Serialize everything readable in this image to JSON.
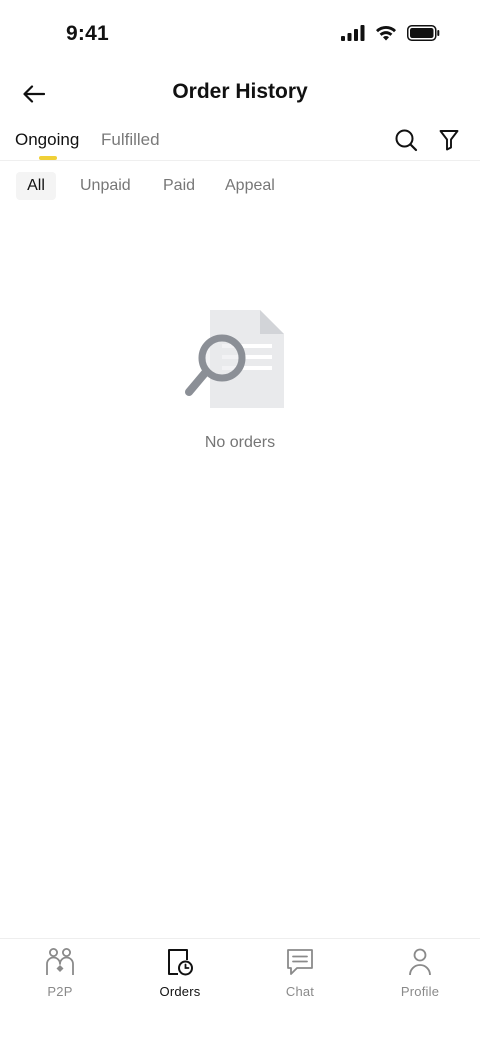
{
  "status_bar": {
    "time": "9:41",
    "icons": [
      "cellular-signal-icon",
      "wifi-icon",
      "battery-icon"
    ]
  },
  "header": {
    "back_icon": "arrow-left-icon",
    "title": "Order History"
  },
  "tabs": {
    "items": [
      {
        "label": "Ongoing",
        "active": true
      },
      {
        "label": "Fulfilled",
        "active": false
      }
    ],
    "indicator_color": "#F0D037",
    "actions": [
      "search-icon",
      "filter-icon"
    ]
  },
  "status_filters": {
    "items": [
      {
        "label": "All",
        "selected": true
      },
      {
        "label": "Unpaid",
        "selected": false
      },
      {
        "label": "Paid",
        "selected": false
      },
      {
        "label": "Appeal",
        "selected": false
      }
    ]
  },
  "empty_state": {
    "icon": "document-search-icon",
    "text": "No orders"
  },
  "bottom_nav": {
    "items": [
      {
        "label": "P2P",
        "icon": "p2p-users-icon",
        "active": false
      },
      {
        "label": "Orders",
        "icon": "orders-clock-icon",
        "active": true
      },
      {
        "label": "Chat",
        "icon": "chat-bubble-icon",
        "active": false
      },
      {
        "label": "Profile",
        "icon": "person-icon",
        "active": false
      }
    ]
  },
  "colors": {
    "accent": "#F0D037",
    "text_primary": "#111111",
    "text_secondary": "#777777",
    "chip_bg": "#F4F4F4"
  }
}
